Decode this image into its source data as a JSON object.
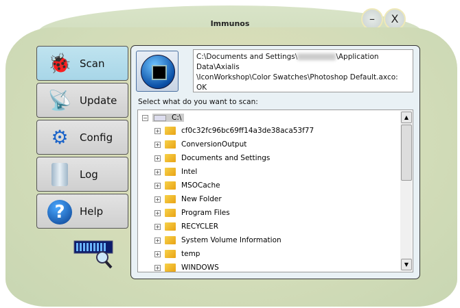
{
  "window": {
    "title": "Immunos",
    "minimize_label": "–",
    "close_label": "X"
  },
  "sidebar": {
    "items": [
      {
        "label": "Scan",
        "icon": "bug-icon",
        "active": true
      },
      {
        "label": "Update",
        "icon": "satellite-dish-icon"
      },
      {
        "label": "Config",
        "icon": "gear-icon"
      },
      {
        "label": "Log",
        "icon": "scroll-icon"
      },
      {
        "label": "Help",
        "icon": "question-icon"
      }
    ]
  },
  "main": {
    "status_line1_prefix": "C:\\Documents and Settings\\",
    "status_line1_suffix": "\\Application Data\\Axialis",
    "status_line2": "\\IconWorkshop\\Color Swatches\\Photoshop Default.axco: OK",
    "prompt": "Select what do you want to scan:",
    "tree": {
      "root": "C:\\",
      "children": [
        "cf0c32fc96bc69ff14a3de38aca53f77",
        "ConversionOutput",
        "Documents and Settings",
        "Intel",
        "MSOCache",
        "New Folder",
        "Program Files",
        "RECYCLER",
        "System Volume Information",
        "temp",
        "WINDOWS"
      ]
    }
  }
}
